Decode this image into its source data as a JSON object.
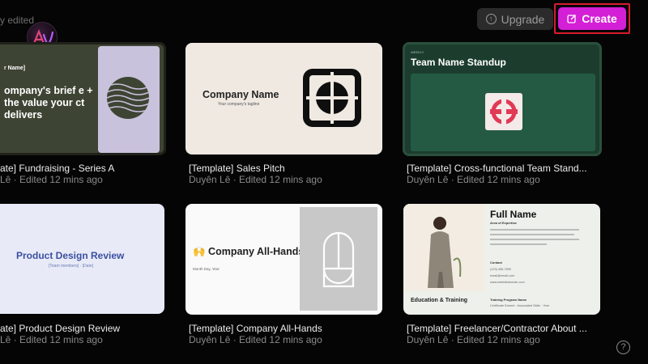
{
  "header": {
    "section_label": "y edited",
    "upgrade_label": "Upgrade",
    "upgrade_icon": "arrow-up-circle-icon",
    "create_label": "Create",
    "create_icon": "edit-icon",
    "accent_color": "#d31fd6",
    "highlight_color": "#d91b2f"
  },
  "cards": [
    {
      "title": "ate] Fundraising - Series A",
      "meta": "Lê · Edited 12 mins ago",
      "thumb": {
        "tag": "r Name]",
        "text": "ompany's brief e + the value your ct delivers"
      }
    },
    {
      "title": "[Template] Sales Pitch",
      "meta": "Duyên Lê · Edited 12 mins ago",
      "thumb": {
        "heading": "Company Name",
        "tagline": "Your company's tagline"
      }
    },
    {
      "title": "[Template] Cross-functional Team Stand...",
      "meta": "Duyên Lê · Edited 12 mins ago",
      "thumb": {
        "tiny": "WEEKLY",
        "heading": "Team Name Standup"
      }
    },
    {
      "title": "ate] Product Design Review",
      "meta": "Lê · Edited 12 mins ago",
      "thumb": {
        "heading": "Product Design Review",
        "sub": "[Team members] · [Date]"
      }
    },
    {
      "title": "[Template] Company All-Hands",
      "meta": "Duyên Lê · Edited 12 mins ago",
      "thumb": {
        "heading": "🙌 Company All-Hands",
        "sub": "Month Day, Year"
      }
    },
    {
      "title": "[Template] Freelancer/Contractor About ...",
      "meta": "Duyên Lê · Edited 12 mins ago",
      "thumb": {
        "heading": "Full Name",
        "area": "Area of Expertise",
        "contact": "Contact",
        "phone": "(123) 456-7890",
        "email": "email@email.com",
        "web": "www.websitedomain.com",
        "education": "Education & Training",
        "program": "Training Program Name",
        "program_sub": "Certificate Earned · Associated Skills · Year"
      }
    }
  ],
  "help_label": "?"
}
